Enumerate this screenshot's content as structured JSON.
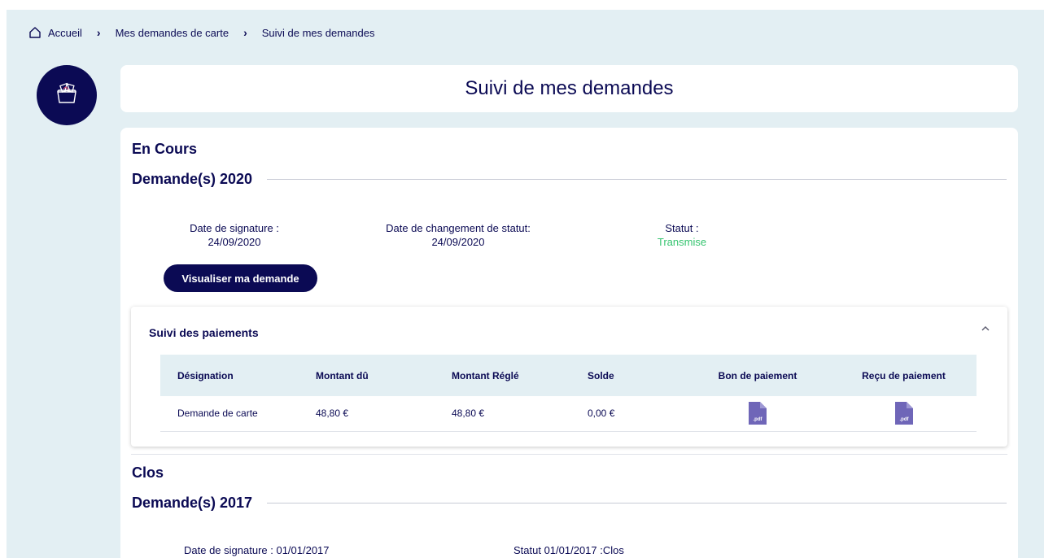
{
  "breadcrumb": {
    "home": "Accueil",
    "level1": "Mes demandes de carte",
    "level2": "Suivi de mes demandes"
  },
  "page_title": "Suivi de mes demandes",
  "en_cours": {
    "label": "En Cours",
    "year_title": "Demande(s) 2020",
    "signature_label": "Date de signature :",
    "signature_value": "24/09/2020",
    "status_change_label": "Date de changement de statut:",
    "status_change_value": "24/09/2020",
    "status_label": "Statut :",
    "status_value": "Transmise",
    "view_button": "Visualiser ma demande"
  },
  "payments": {
    "title": "Suivi des paiements",
    "columns": [
      "Désignation",
      "Montant dû",
      "Montant Réglé",
      "Solde",
      "Bon de paiement",
      "Reçu de paiement"
    ],
    "rows": [
      {
        "designation": "Demande de carte",
        "montant_du": "48,80 €",
        "montant_regle": "48,80 €",
        "solde": "0,00 €",
        "bon": ".pdf",
        "recu": ".pdf"
      }
    ]
  },
  "clos": {
    "label": "Clos",
    "year_title": "Demande(s) 2017",
    "signature": "Date de signature : 01/01/2017",
    "status": "Statut 01/01/2017 :Clos"
  },
  "colors": {
    "brand_navy": "#0b0a54",
    "status_green": "#35c46f",
    "background": "#e3eff3",
    "pdf_purple": "#6f66b8"
  }
}
